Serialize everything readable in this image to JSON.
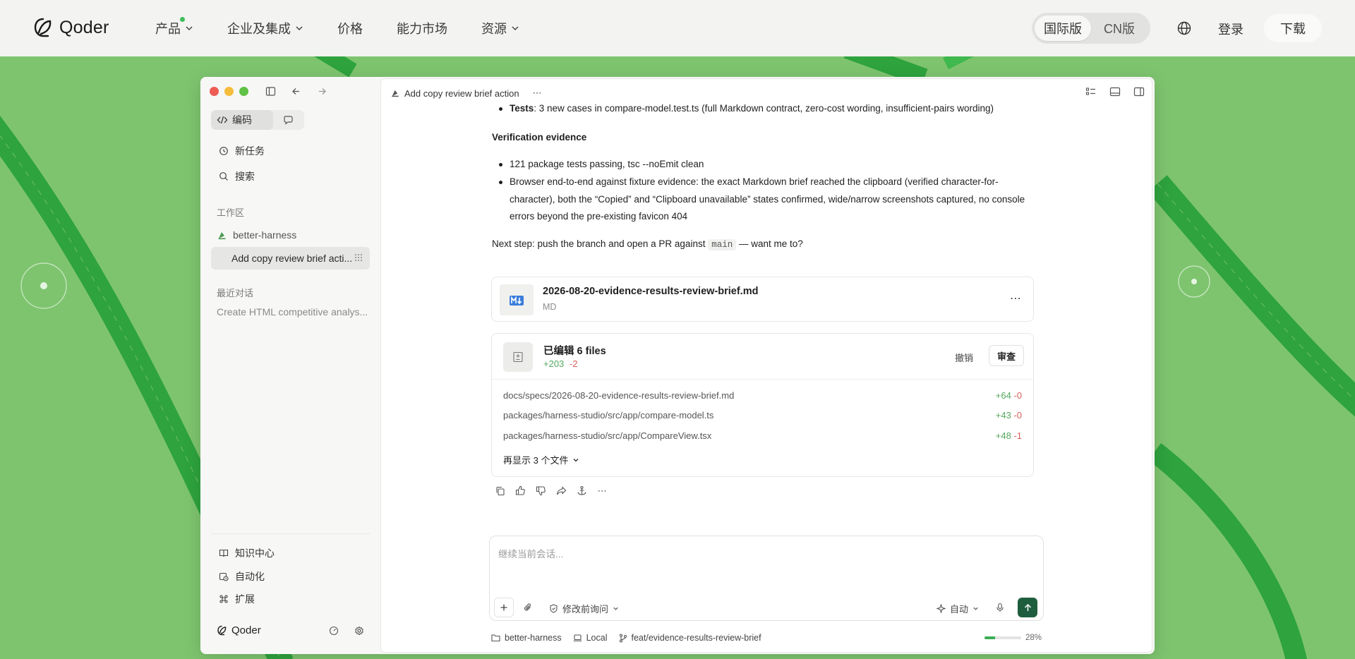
{
  "brand": {
    "name": "Qoder"
  },
  "nav": {
    "items": [
      {
        "label": "产品",
        "has_dot": true,
        "has_chevron": true
      },
      {
        "label": "企业及集成",
        "has_chevron": true
      },
      {
        "label": "价格"
      },
      {
        "label": "能力市场"
      },
      {
        "label": "资源",
        "has_chevron": true
      }
    ],
    "region": {
      "options": [
        "国际版",
        "CN版"
      ],
      "selected": "国际版"
    },
    "login": "登录",
    "download": "下载"
  },
  "app": {
    "sidebar": {
      "mode_label": "编码",
      "new_task": "新任务",
      "search": "搜索",
      "workspace_title": "工作区",
      "repo": "better-harness",
      "active_task": "Add copy review brief acti...",
      "recent_title": "最近对话",
      "recent_item": "Create HTML competitive analys...",
      "knowledge": "知识中心",
      "automation": "自动化",
      "extensions": "扩展",
      "footer_brand": "Qoder"
    },
    "header": {
      "task_title": "Add copy review brief action"
    },
    "message": {
      "tests_label": "Tests",
      "tests_text": ": 3 new cases in compare-model.test.ts (full Markdown contract, zero-cost wording, insufficient-pairs wording)",
      "verification_heading": "Verification evidence",
      "bullet1": "121 package tests passing, tsc --noEmit clean",
      "bullet2": "Browser end-to-end against fixture evidence: the exact Markdown brief reached the clipboard (verified character-for-character), both the “Copied” and “Clipboard unavailable” states confirmed, wide/narrow screenshots captured, no console errors beyond the pre-existing favicon 404",
      "next_step_prefix": "Next step: push the branch and open a PR against ",
      "next_step_code": "main",
      "next_step_suffix": " — want me to?"
    },
    "file_card": {
      "name": "2026-08-20-evidence-results-review-brief.md",
      "type": "MD"
    },
    "edit_card": {
      "title": "已编辑 6 files",
      "added": "+203",
      "removed": "-2",
      "undo": "撤销",
      "review": "审查",
      "files": [
        {
          "path": "docs/specs/2026-08-20-evidence-results-review-brief.md",
          "added": "+64",
          "removed": "-0"
        },
        {
          "path": "packages/harness-studio/src/app/compare-model.ts",
          "added": "+43",
          "removed": "-0"
        },
        {
          "path": "packages/harness-studio/src/app/CompareView.tsx",
          "added": "+48",
          "removed": "-1"
        }
      ],
      "show_more": "再显示 3 个文件"
    },
    "composer": {
      "placeholder": "继续当前会话...",
      "permission": "修改前询问",
      "model": "自动"
    },
    "status": {
      "repo": "better-harness",
      "env": "Local",
      "branch": "feat/evidence-results-review-brief",
      "context_percent": "28%",
      "context_fraction": 0.28
    }
  },
  "colors": {
    "accent": "#1e5e3e",
    "background": "#7ec46f",
    "stripe": "#2fa83f"
  }
}
